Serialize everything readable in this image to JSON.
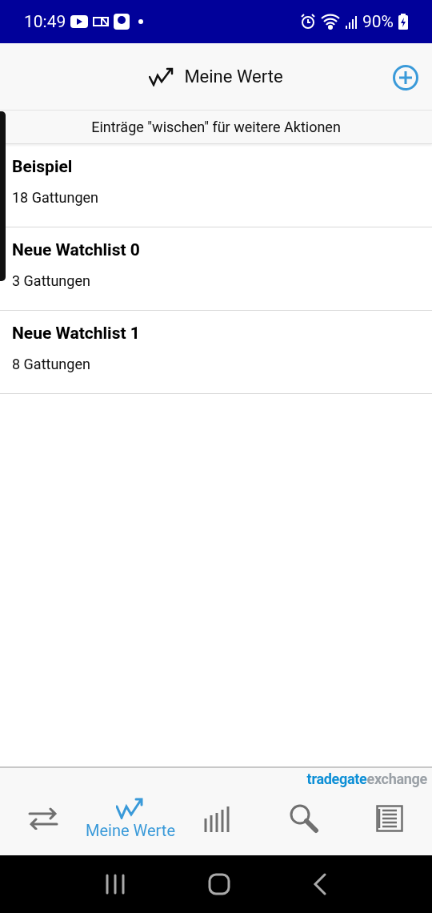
{
  "status_bar": {
    "time": "10:49",
    "battery": "90%"
  },
  "header": {
    "title": "Meine Werte"
  },
  "hint": "Einträge \"wischen\" für weitere Aktionen",
  "watchlists": [
    {
      "name": "Beispiel",
      "count": "18 Gattungen"
    },
    {
      "name": "Neue Watchlist 0",
      "count": "3 Gattungen"
    },
    {
      "name": "Neue Watchlist 1",
      "count": "8 Gattungen"
    }
  ],
  "logo": {
    "part_1": "tradegate",
    "part_2": "exchange"
  },
  "tabs": [
    {
      "kind": "transfer",
      "selected": false
    },
    {
      "kind": "chart",
      "label": "Meine Werte",
      "selected": true
    },
    {
      "kind": "bars",
      "selected": false
    },
    {
      "kind": "search",
      "selected": false
    },
    {
      "kind": "news",
      "selected": false
    }
  ]
}
